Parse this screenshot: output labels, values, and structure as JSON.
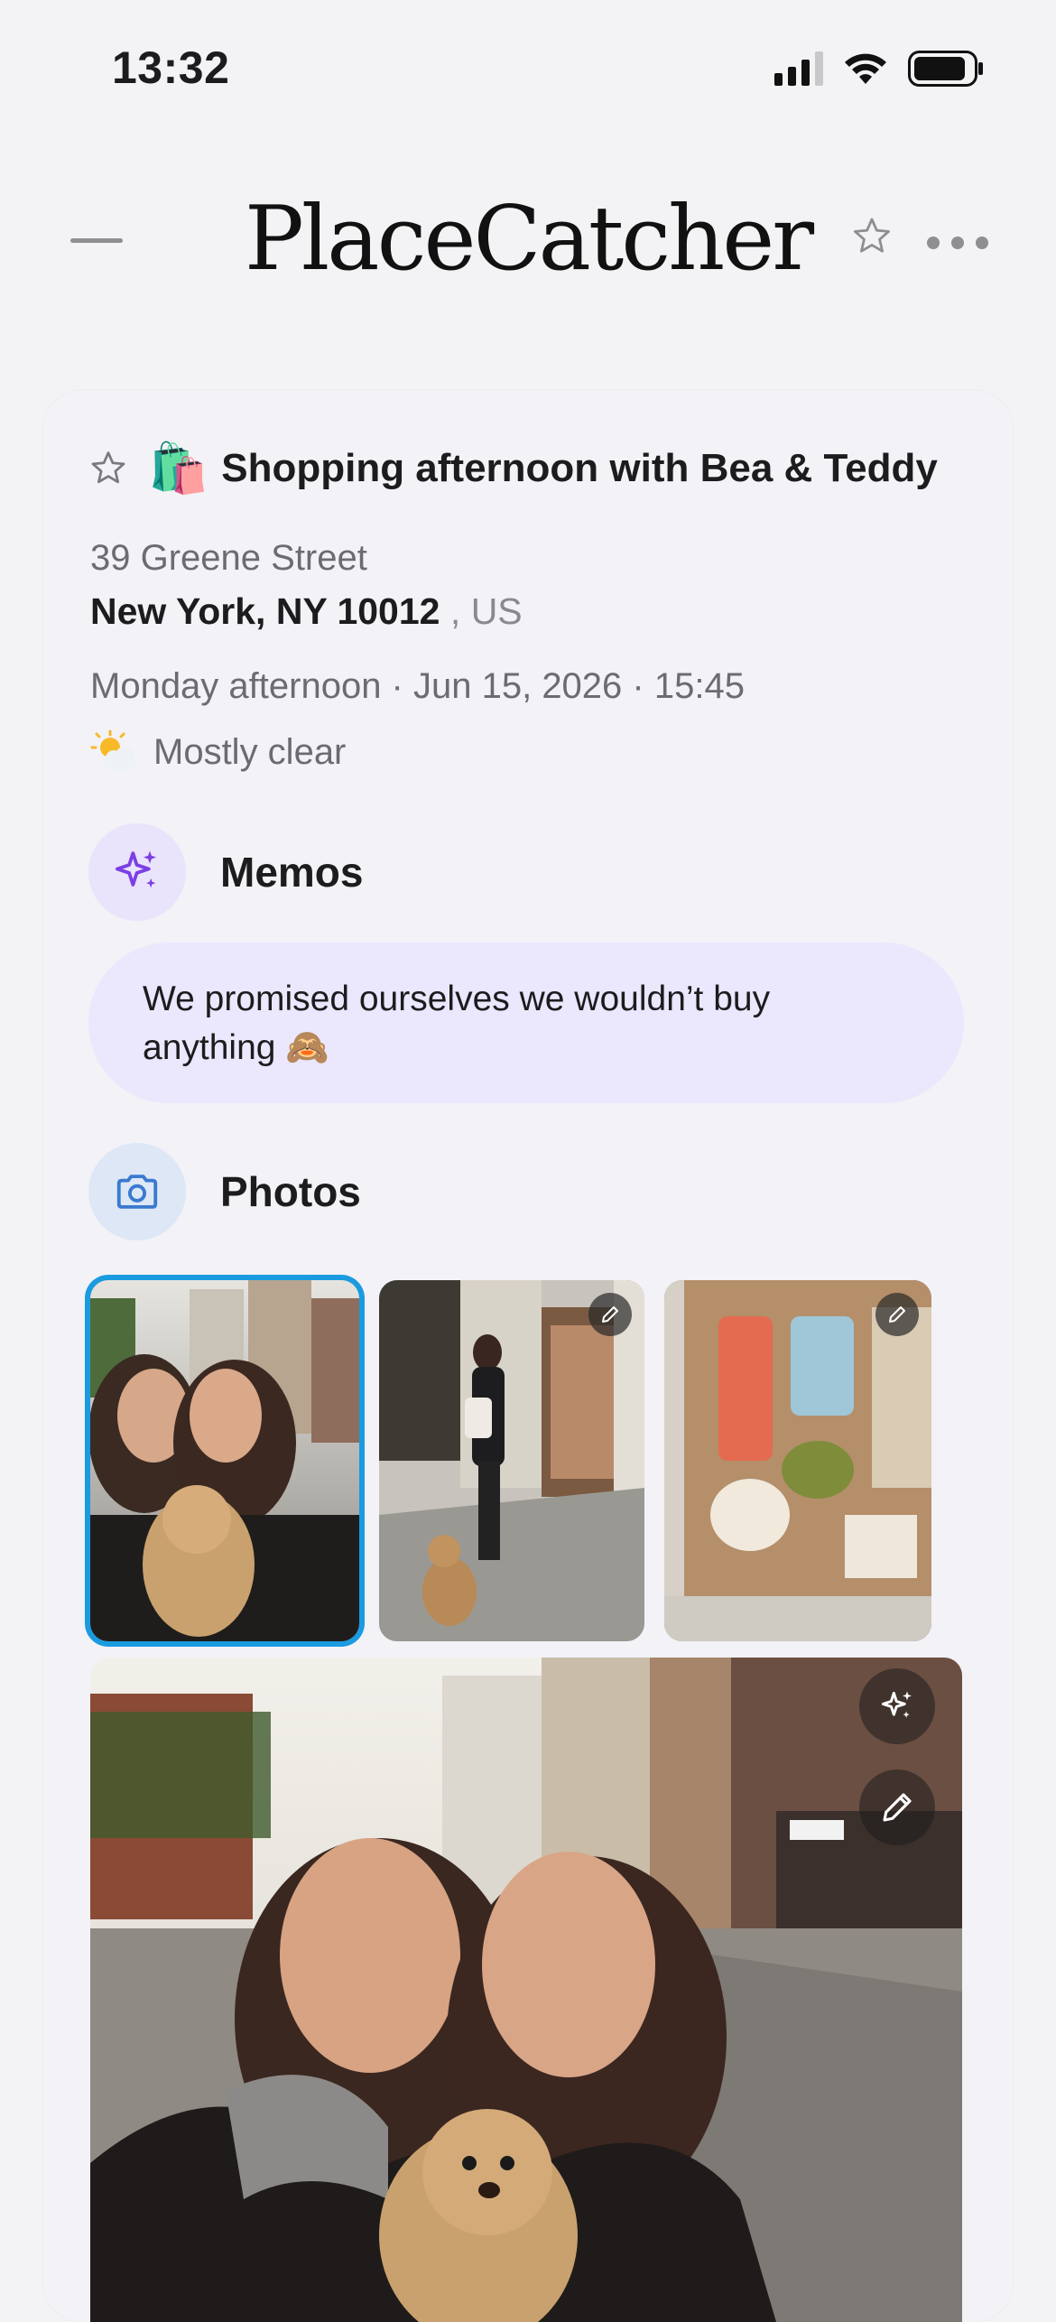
{
  "status_bar": {
    "time": "13:32"
  },
  "nav": {
    "app_title": "PlaceCatcher",
    "icons": [
      "menu-icon",
      "star-icon",
      "more-icon"
    ]
  },
  "place": {
    "emoji": "🛍️",
    "title": "Shopping afternoon with Bea & Teddy",
    "street": "39 Greene Street",
    "city": "New York, NY 10012",
    "country_separator": ",",
    "country": "US",
    "datetime": "Monday afternoon · Jun 15, 2026 · 15:45",
    "weather": "Mostly clear"
  },
  "memos": {
    "title": "Memos",
    "text": "We promised ourselves we wouldn’t buy anything 🙈"
  },
  "photos": {
    "title": "Photos",
    "items": [
      {
        "name": "selfie-with-dog",
        "selected": true,
        "editable": false
      },
      {
        "name": "woman-with-dog-street",
        "selected": false,
        "editable": true
      },
      {
        "name": "shop-window",
        "selected": false,
        "editable": true
      }
    ],
    "hero": {
      "name": "selfie-large",
      "ai": true,
      "editable": true
    }
  },
  "colors": {
    "accent_purple": "#7b3fe4",
    "memo_bg": "#ebe7fd",
    "photo_icon_bg": "#dde7f6",
    "photo_icon": "#3a79d0",
    "selected_border": "#1a9be0"
  }
}
